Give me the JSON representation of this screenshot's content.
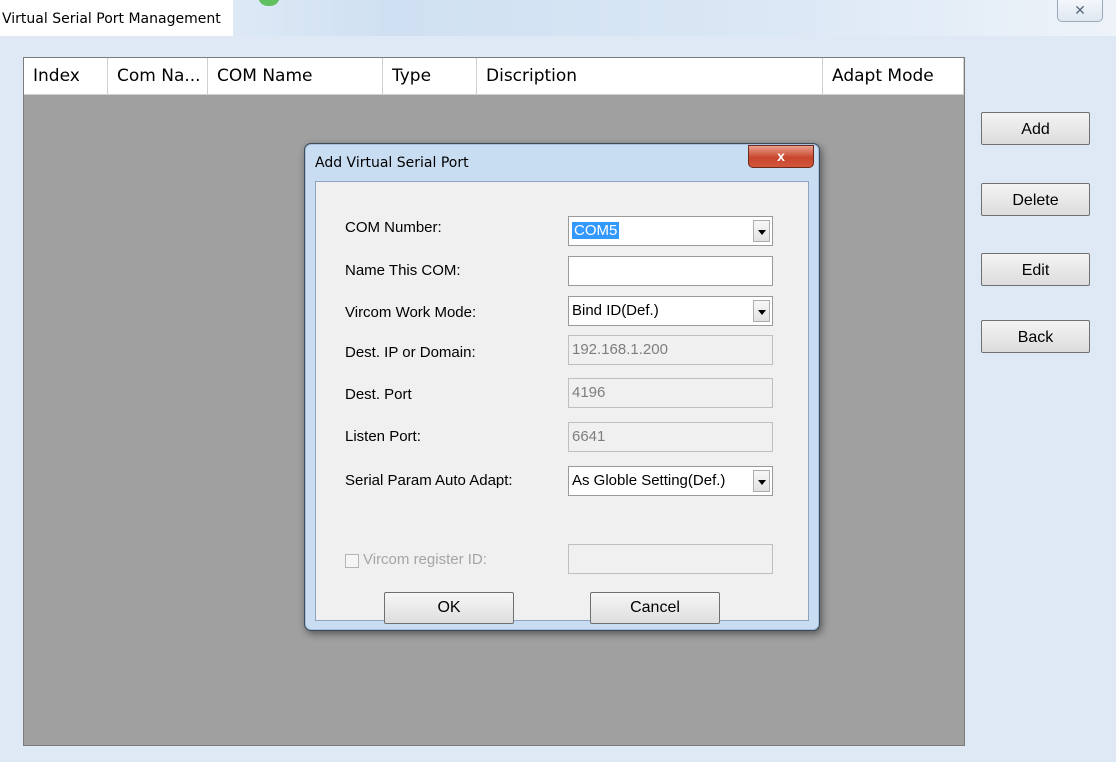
{
  "window": {
    "title": "Virtual Serial Port Management",
    "close_glyph": "✕"
  },
  "list": {
    "columns": [
      "Index",
      "Com Na...",
      "COM Name",
      "Type",
      "Discription",
      "Adapt Mode"
    ]
  },
  "side_buttons": {
    "add": "Add",
    "delete": "Delete",
    "edit": "Edit",
    "back": "Back"
  },
  "dialog": {
    "title": "Add Virtual Serial Port",
    "close_glyph": "x",
    "fields": {
      "com_number": {
        "label": "COM Number:",
        "value": "COM5"
      },
      "name_this_com": {
        "label": "Name This COM:",
        "value": ""
      },
      "work_mode": {
        "label": "Vircom Work Mode:",
        "value": "Bind ID(Def.)"
      },
      "dest_ip": {
        "label": "Dest. IP or Domain:",
        "value": "192.168.1.200"
      },
      "dest_port": {
        "label": "Dest. Port",
        "value": "4196"
      },
      "listen_port": {
        "label": "Listen Port:",
        "value": "6641"
      },
      "auto_adapt": {
        "label": "Serial Param Auto Adapt:",
        "value": "As Globle Setting(Def.)"
      },
      "register_id": {
        "label": "Vircom register ID:",
        "value": "",
        "checked": false
      }
    },
    "ok_label": "OK",
    "cancel_label": "Cancel"
  },
  "colors": {
    "window_bg": "#dfe9f6",
    "list_bg": "#a0a0a0",
    "dialog_frame": "#c9ddf2",
    "dialog_close": "#c8452d",
    "selection": "#3399ff"
  }
}
